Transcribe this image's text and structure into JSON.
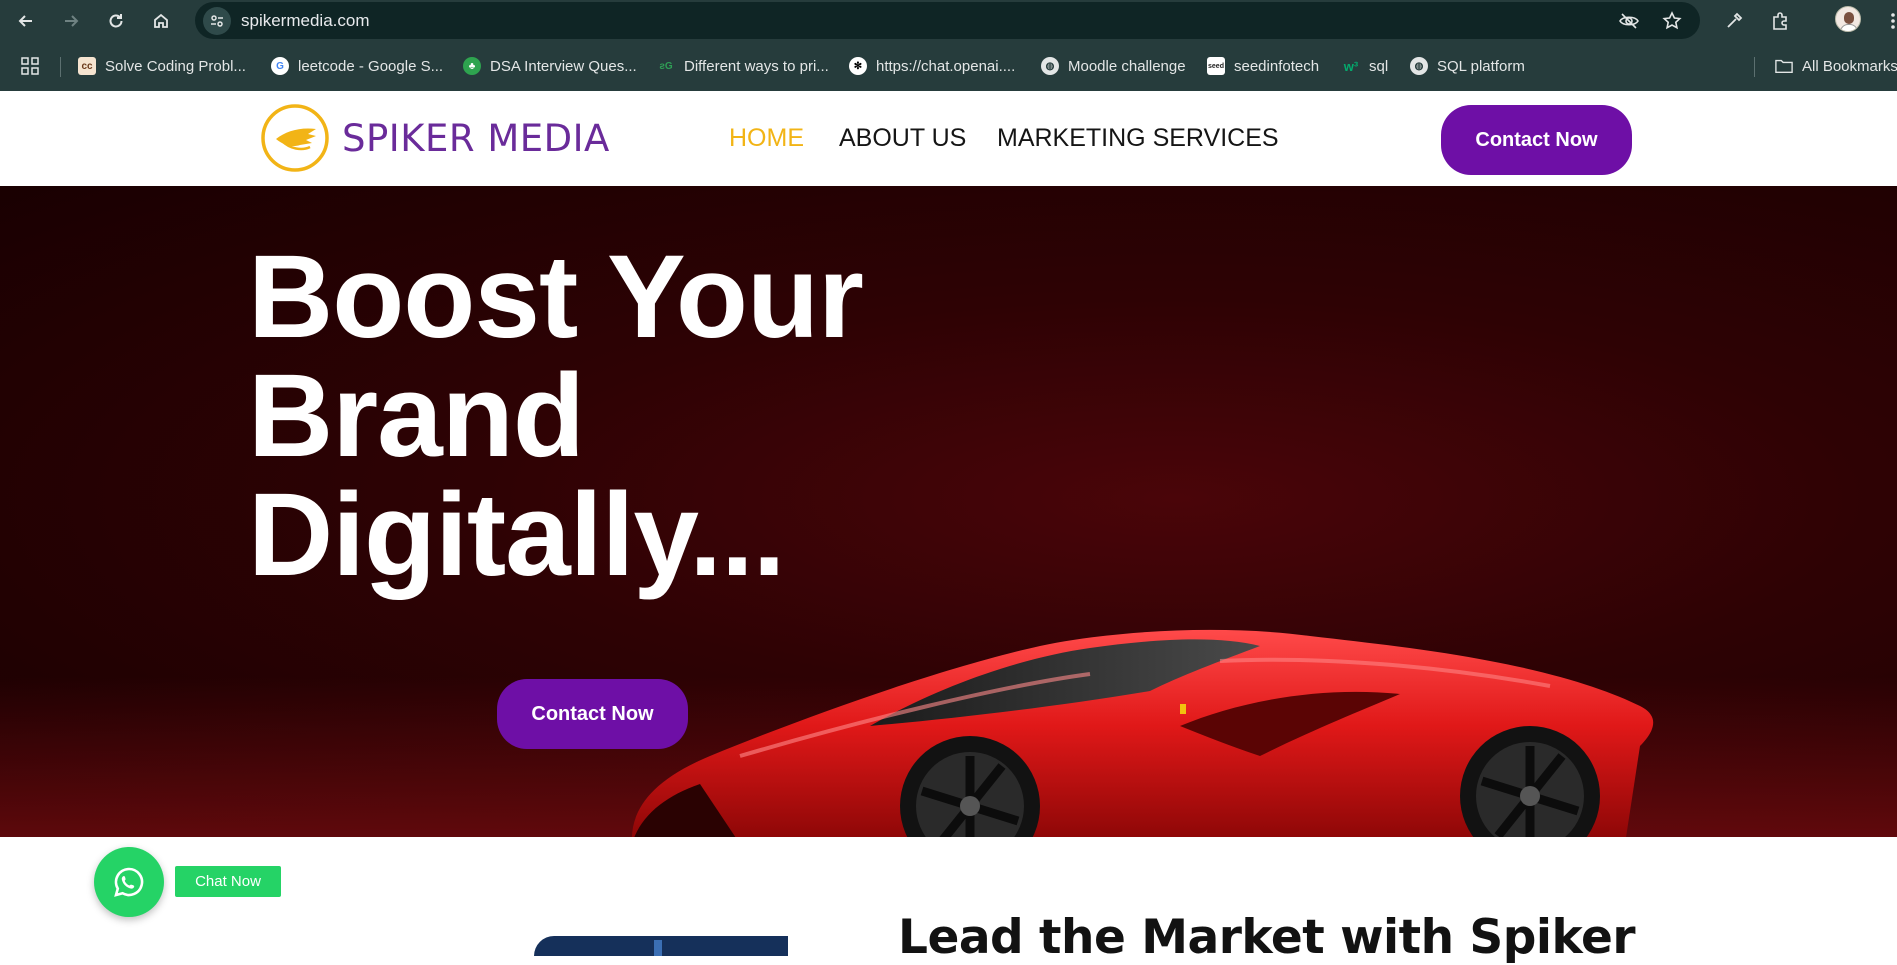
{
  "browser": {
    "url": "spikermedia.com",
    "bookmarks": [
      {
        "label": "Solve Coding Probl...",
        "icon": "cc"
      },
      {
        "label": "leetcode - Google S...",
        "icon": "G"
      },
      {
        "label": "DSA Interview Ques...",
        "icon": "leaf"
      },
      {
        "label": "Different ways to pri...",
        "icon": "gfg"
      },
      {
        "label": "https://chat.openai....",
        "icon": "openai"
      },
      {
        "label": "Moodle challenge",
        "icon": "globe"
      },
      {
        "label": "seedinfotech",
        "icon": "seed"
      },
      {
        "label": "sql",
        "icon": "w3"
      },
      {
        "label": "SQL platform",
        "icon": "globe"
      },
      {
        "label": "All Bookmarks",
        "icon": "folder"
      }
    ]
  },
  "header": {
    "logo_text": "SPIKER MEDIA",
    "nav": [
      {
        "label": "HOME",
        "active": true
      },
      {
        "label": "ABOUT US",
        "active": false
      },
      {
        "label": "MARKETING SERVICES",
        "active": false
      }
    ],
    "cta_label": "Contact Now"
  },
  "hero": {
    "title_lines": [
      "Boost Your",
      "Brand",
      "Digitally..."
    ],
    "cta_label": "Contact Now"
  },
  "chat": {
    "label": "Chat Now"
  },
  "section": {
    "heading": "Lead the Market with Spiker"
  },
  "colors": {
    "brand_purple": "#6e0fa6",
    "nav_active": "#f2b416",
    "whatsapp_green": "#25d366",
    "hero_bg": "#2e0204"
  }
}
